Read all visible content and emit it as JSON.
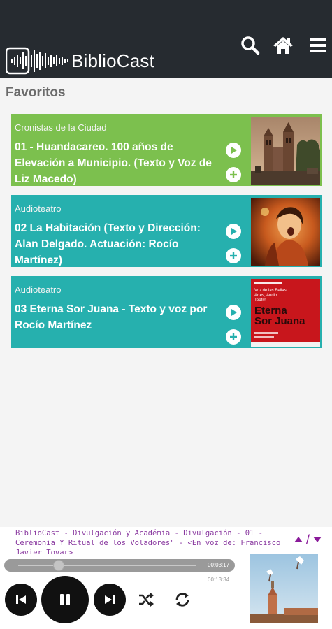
{
  "app": {
    "name": "BiblioCast"
  },
  "header": {
    "icons": [
      "search-icon",
      "home-icon",
      "menu-icon"
    ]
  },
  "page": {
    "title": "Favoritos"
  },
  "favorites": [
    {
      "category": "Cronistas de la Ciudad",
      "title": "01 - Huandacareo. 100 años de Elevación a Municipio. (Texto y Voz de Liz Macedo)",
      "color": "#7cc04e"
    },
    {
      "category": "Audioteatro",
      "title": "02  La Habitación (Texto y Dirección: Alan Delgado. Actuación: Rocío Martínez)",
      "color": "#26b0ae"
    },
    {
      "category": "Audioteatro",
      "title": "03 Eterna Sor Juana - Texto y voz por Rocío Martínez",
      "color": "#26b0ae"
    }
  ],
  "thumb3": {
    "heading": "Voz de las Bellas Artes, Audio Teatro",
    "title_line1": "Eterna",
    "title_line2": "Sor Juana"
  },
  "player": {
    "now_playing": "BiblioCast - Divulgación y Académia - Divulgación - 01 - Ceremonia Y Ritual de los Voladores\" - <En voz de: Francisco Javier Tovar>",
    "current_time": "00:03:17",
    "total_time": "00:13:34",
    "progress": 0.24,
    "arrow_separator": "/"
  },
  "colors": {
    "header_bg": "#262b30",
    "green_card": "#7cc04e",
    "teal_card": "#26b0ae",
    "marquee_text": "#8a3aa0"
  }
}
